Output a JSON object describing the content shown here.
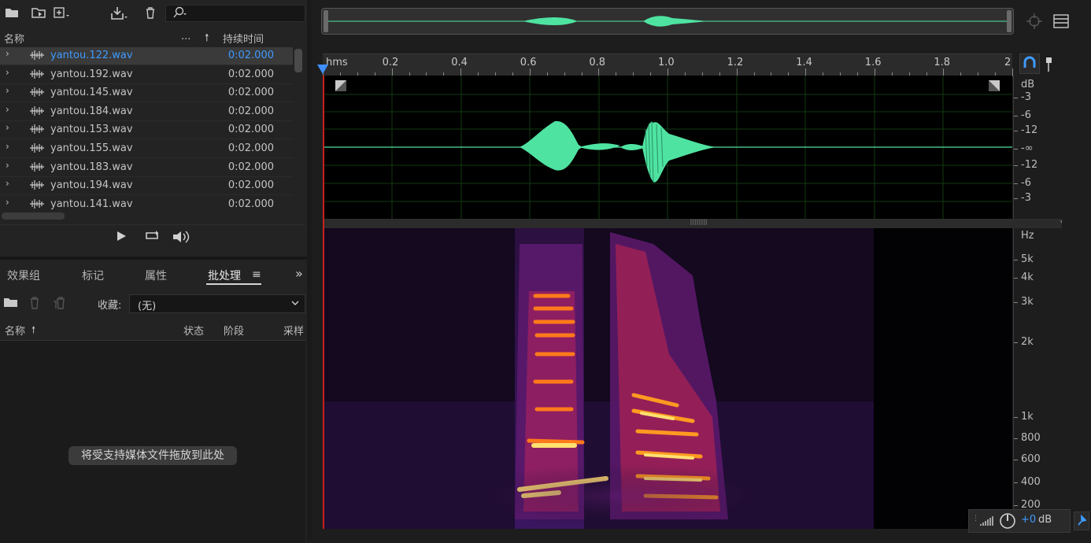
{
  "files": {
    "header": {
      "name_label": "名称",
      "dots_label": "...",
      "duration_label": "持续时间"
    },
    "rows": [
      {
        "name": "yantou.122.wav",
        "duration": "0:02.000",
        "selected": true
      },
      {
        "name": "yantou.192.wav",
        "duration": "0:02.000"
      },
      {
        "name": "yantou.145.wav",
        "duration": "0:02.000"
      },
      {
        "name": "yantou.184.wav",
        "duration": "0:02.000"
      },
      {
        "name": "yantou.153.wav",
        "duration": "0:02.000"
      },
      {
        "name": "yantou.155.wav",
        "duration": "0:02.000"
      },
      {
        "name": "yantou.183.wav",
        "duration": "0:02.000"
      },
      {
        "name": "yantou.194.wav",
        "duration": "0:02.000"
      },
      {
        "name": "yantou.141.wav",
        "duration": "0:02.000"
      }
    ]
  },
  "batch": {
    "tabs": [
      "效果组",
      "标记",
      "属性",
      "批处理"
    ],
    "active_tab": "批处理",
    "collect_label": "收藏:",
    "collect_value": "(无)",
    "columns": {
      "name": "名称",
      "status": "状态",
      "stage": "阶段",
      "sample": "采样"
    },
    "drop_hint": "将受支持媒体文件拖放到此处"
  },
  "timeline": {
    "unit_label": "hms",
    "ticks": [
      "0.2",
      "0.4",
      "0.6",
      "0.8",
      "1.0",
      "1.2",
      "1.4",
      "1.6",
      "1.8",
      "2"
    ]
  },
  "db_scale": {
    "unit": "dB",
    "labels": [
      "-3",
      "-6",
      "-12",
      "-∞",
      "-12",
      "-6",
      "-3"
    ]
  },
  "hz_scale": {
    "unit": "Hz",
    "labels": [
      "5k",
      "4k",
      "3k",
      "2k",
      "1k",
      "800",
      "600",
      "400",
      "200"
    ]
  },
  "level": {
    "value": "+0",
    "unit": "dB"
  },
  "colors": {
    "waveform": "#4fe3a1",
    "accent": "#3f9bff"
  }
}
